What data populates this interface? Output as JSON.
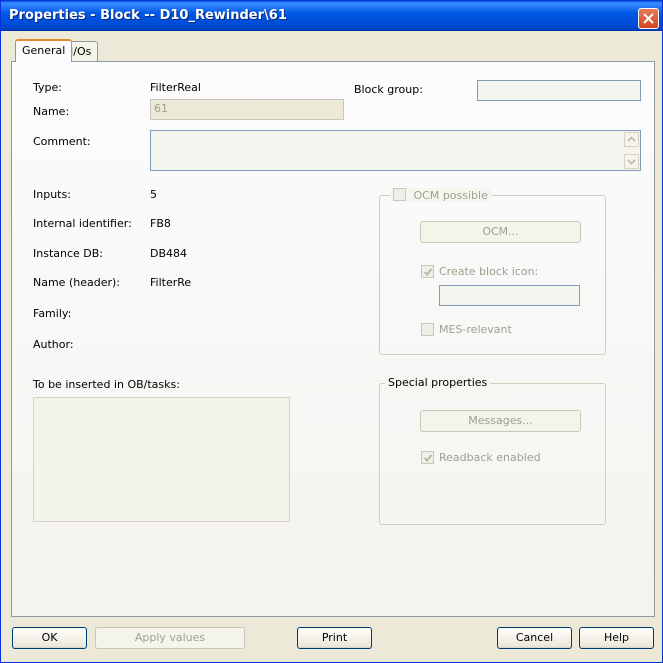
{
  "window": {
    "title": "Properties - Block -- D10_Rewinder\\61"
  },
  "tabs": [
    {
      "label": "General"
    },
    {
      "label": "I/Os"
    }
  ],
  "general": {
    "type_label": "Type:",
    "type_value": "FilterReal",
    "name_label": "Name:",
    "name_value": "61",
    "block_group_label": "Block group:",
    "block_group_value": "",
    "comment_label": "Comment:",
    "comment_value": "",
    "inputs_label": "Inputs:",
    "inputs_value": "5",
    "internal_id_label": "Internal identifier:",
    "internal_id_value": "FB8",
    "instance_db_label": "Instance DB:",
    "instance_db_value": "DB484",
    "name_header_label": "Name (header):",
    "name_header_value": "FilterRe",
    "family_label": "Family:",
    "family_value": "",
    "author_label": "Author:",
    "author_value": "",
    "ob_tasks_label": "To be inserted in OB/tasks:"
  },
  "ocm": {
    "possible_label": "OCM possible",
    "possible_checked": false,
    "ocm_button": "OCM...",
    "create_icon_label": "Create block icon:",
    "create_icon_checked": true,
    "create_icon_value": "",
    "mes_label": "MES-relevant",
    "mes_checked": false
  },
  "special": {
    "group_label": "Special properties",
    "messages_button": "Messages...",
    "readback_label": "Readback enabled",
    "readback_checked": true
  },
  "buttons": {
    "ok": "OK",
    "apply": "Apply values",
    "print": "Print",
    "cancel": "Cancel",
    "help": "Help"
  },
  "colors": {
    "title_bar": "#0058e6",
    "dialog_bg": "#ece9d8",
    "tab_accent": "#e68b2c"
  }
}
